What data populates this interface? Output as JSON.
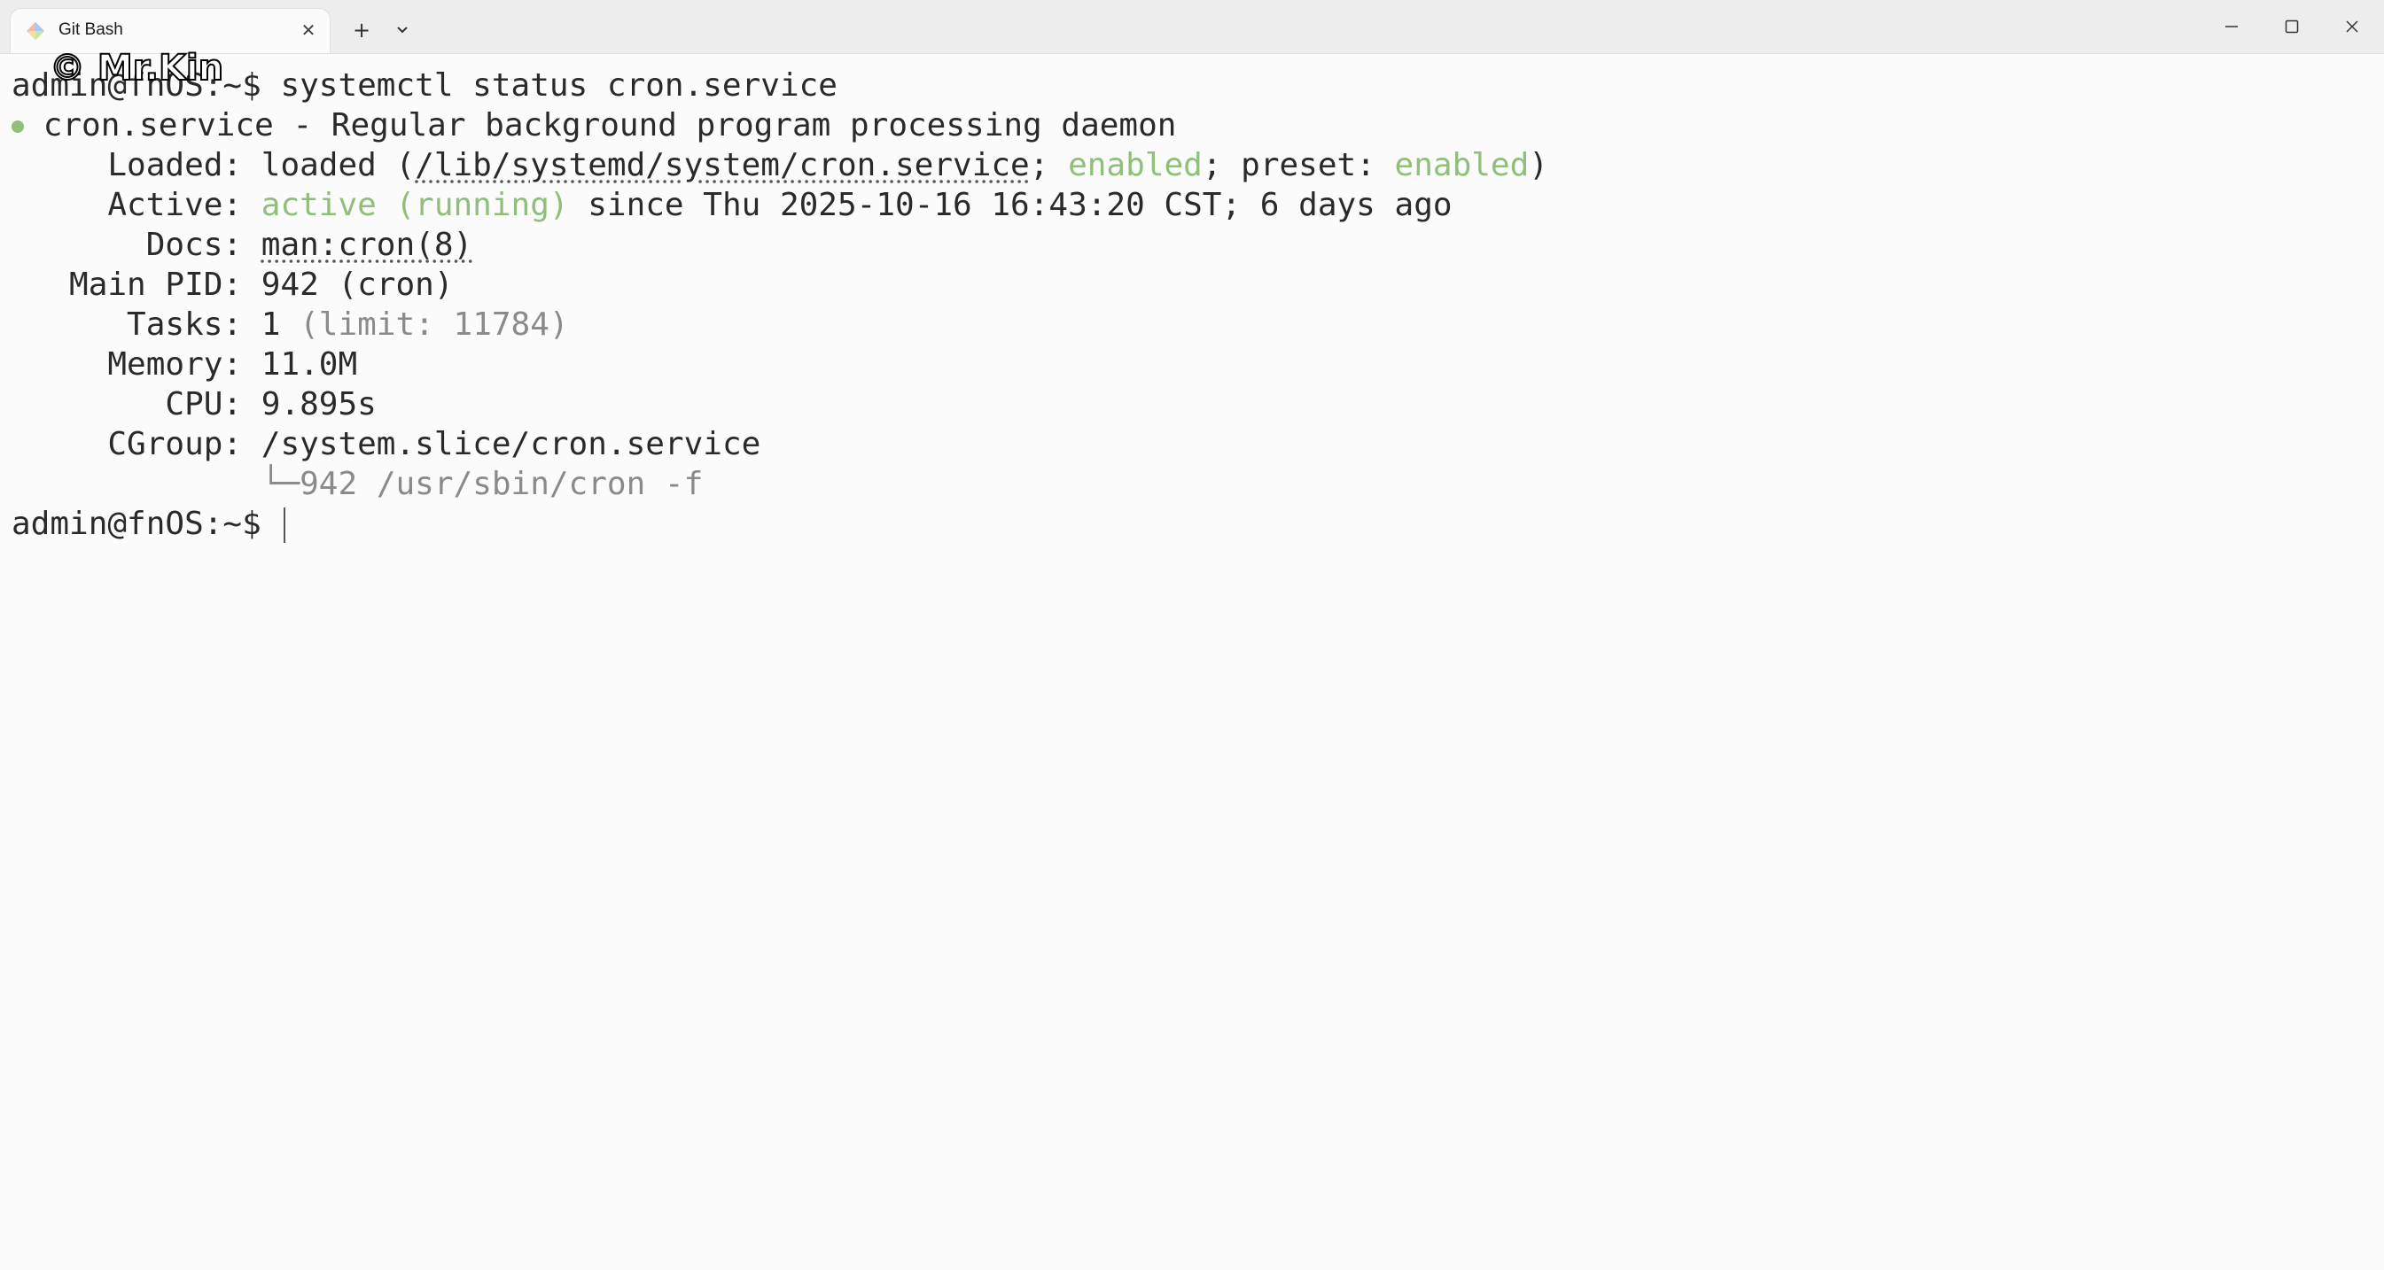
{
  "window": {
    "tab_title": "Git Bash",
    "tab_close_glyph": "✕",
    "new_tab_glyph": "+",
    "icons": {
      "tab": "git-bash-icon",
      "dropdown": "chevron-down-icon",
      "minimize": "minimize-icon",
      "maximize": "maximize-icon",
      "close": "close-icon"
    }
  },
  "watermark": "© Mr.Kin",
  "terminal": {
    "colors": {
      "text": "#2a2a2a",
      "green": "#8fbf7a",
      "gray": "#8a8a8a",
      "background": "#fbfbfb"
    },
    "command_line": {
      "prompt": "admin@fnOS:~$ ",
      "command": "systemctl status cron.service"
    },
    "service_line": {
      "text": "cron.service - Regular background program processing daemon"
    },
    "loaded": {
      "label": "     Loaded: ",
      "value_prefix": "loaded (",
      "path": "/lib/systemd/system/cron.service",
      "sep1": "; ",
      "enabled": "enabled",
      "sep2": "; preset: ",
      "preset": "enabled",
      "suffix": ")"
    },
    "active": {
      "label": "     Active: ",
      "state": "active (running)",
      "since": " since Thu 2025-10-16 16:43:20 CST; 6 days ago"
    },
    "docs": {
      "label": "       Docs: ",
      "value": "man:cron(8)"
    },
    "main_pid": {
      "label": "   Main PID: ",
      "value": "942 (cron)"
    },
    "tasks": {
      "label": "      Tasks: ",
      "value": "1",
      "limit": " (limit: 11784)"
    },
    "memory": {
      "label": "     Memory: ",
      "value": "11.0M"
    },
    "cpu": {
      "label": "        CPU: ",
      "value": "9.895s"
    },
    "cgroup": {
      "label": "     CGroup: ",
      "value": "/system.slice/cron.service"
    },
    "cgroup_child": {
      "indent": "             ",
      "branch": "└─",
      "value": "942 /usr/sbin/cron -f"
    },
    "final_prompt": {
      "prompt": "admin@fnOS:~$ "
    }
  }
}
